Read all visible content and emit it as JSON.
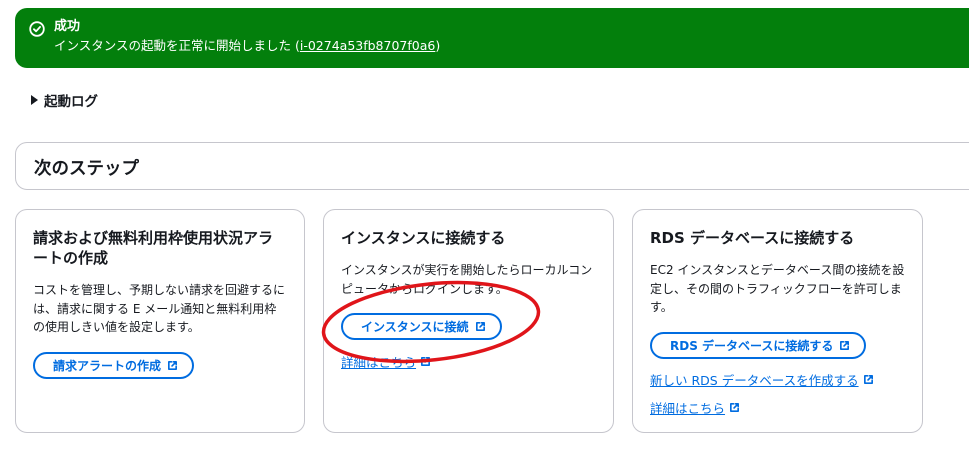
{
  "flash": {
    "title": "成功",
    "message_prefix": "インスタンスの起動を正常に開始しました (",
    "instance_id": "i-0274a53fb8707f0a6",
    "message_suffix": ")",
    "color": "#037f0c"
  },
  "launch_log": {
    "label": "起動ログ"
  },
  "next_steps": {
    "title": "次のステップ"
  },
  "cards": [
    {
      "title": "請求および無料利用枠使用状況アラートの作成",
      "description": "コストを管理し、予期しない請求を回避するには、請求に関する E メール通知と無料利用枠の使用しきい値を設定します。",
      "button": "請求アラートの作成"
    },
    {
      "title": "インスタンスに接続する",
      "description": "インスタンスが実行を開始したらローカルコンピュータからログインします。",
      "button": "インスタンスに接続",
      "link": "詳細はこちら"
    },
    {
      "title": "RDS データベースに接続する",
      "description": "EC2 インスタンスとデータベース間の接続を設定し、その間のトラフィックフローを許可します。",
      "button": "RDS データベースに接続する",
      "link1": "新しい RDS データベースを作成する",
      "link2": "詳細はこちら"
    }
  ],
  "colors": {
    "accent": "#006ce0",
    "annotation": "#e0151a"
  },
  "icons": {
    "success": "check-circle-icon",
    "external": "external-link-icon",
    "expand": "caret-right-icon"
  }
}
